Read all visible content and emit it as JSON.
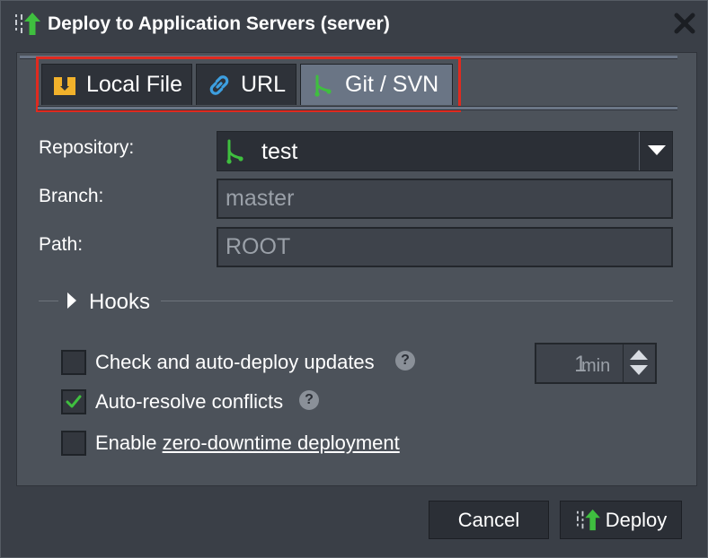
{
  "dialog": {
    "title": "Deploy to Application Servers (server)",
    "title_icon": "deploy-icon",
    "close_icon": "close-icon"
  },
  "tabs": [
    {
      "label": "Local File",
      "icon": "archive-icon",
      "icon_color": "#f2b22b",
      "active": false
    },
    {
      "label": "URL",
      "icon": "link-icon",
      "icon_color": "#3d9fe0",
      "active": false
    },
    {
      "label": "Git / SVN",
      "icon": "git-branch-icon",
      "icon_color": "#3fbf3f",
      "active": true
    }
  ],
  "form": {
    "repository_label": "Repository:",
    "repository_value": "test",
    "branch_label": "Branch:",
    "branch_value": "master",
    "path_label": "Path:",
    "path_value": "ROOT"
  },
  "hooks": {
    "label": "Hooks"
  },
  "options": {
    "auto_deploy": {
      "label": "Check and auto-deploy updates",
      "checked": false
    },
    "interval": {
      "value": "1",
      "unit": "min"
    },
    "auto_resolve": {
      "label": "Auto-resolve conflicts",
      "checked": true
    },
    "zero_downtime": {
      "label_prefix": "Enable ",
      "label_link": "zero-downtime deployment",
      "checked": false
    }
  },
  "help_text": "?",
  "buttons": {
    "cancel": "Cancel",
    "deploy": "Deploy"
  },
  "colors": {
    "highlight": "#e02a1f",
    "check": "#3fbf3f",
    "deploy_arrow": "#3fbf3f"
  }
}
